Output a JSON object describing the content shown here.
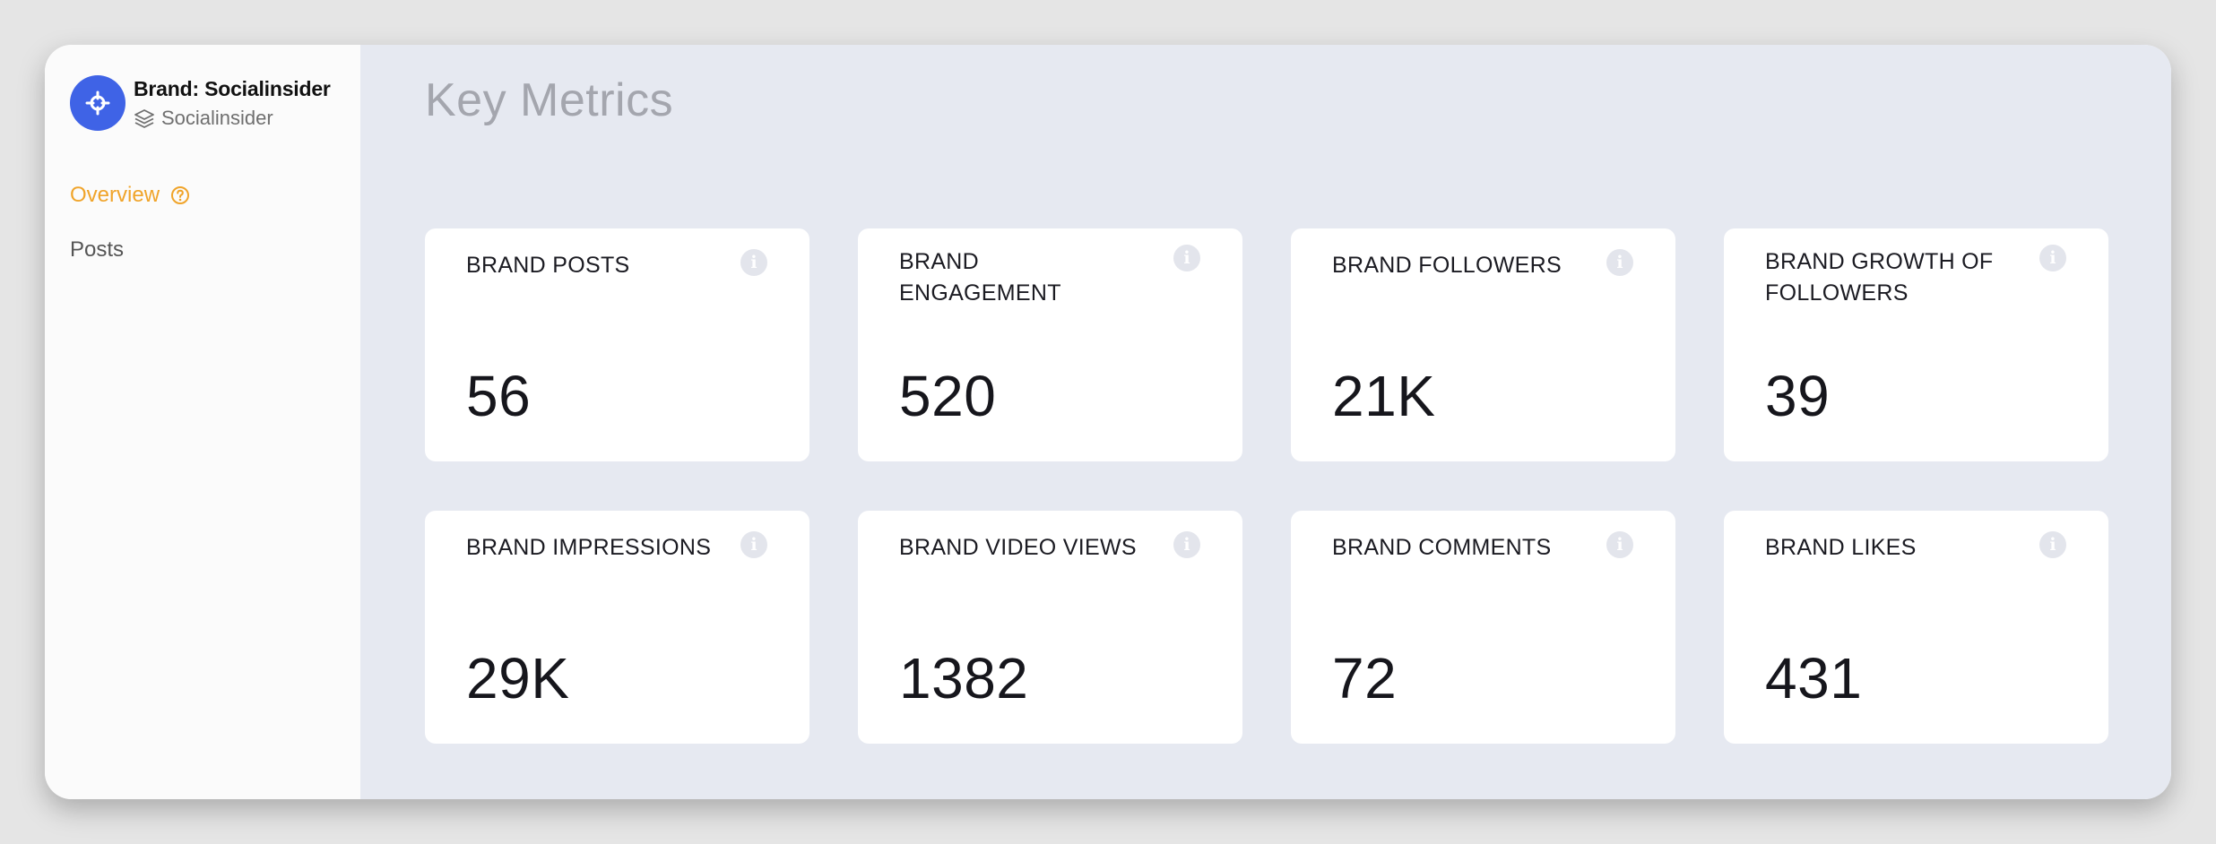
{
  "brand": {
    "name": "Brand: Socialinsider",
    "account": "Socialinsider",
    "avatar_color": "#3f63e6"
  },
  "nav": {
    "items": [
      {
        "label": "Overview",
        "active": true,
        "icon": "help-circle-icon"
      },
      {
        "label": "Posts",
        "active": false
      }
    ],
    "active_color": "#f0a42a"
  },
  "main": {
    "title": "Key Metrics",
    "metrics": [
      {
        "label": "BRAND POSTS",
        "value": "56",
        "icon": "info-icon"
      },
      {
        "label": "BRAND ENGAGEMENT",
        "value": "520",
        "icon": "info-icon"
      },
      {
        "label": "BRAND FOLLOWERS",
        "value": "21K",
        "icon": "info-icon"
      },
      {
        "label": "BRAND GROWTH OF FOLLOWERS",
        "value": "39",
        "icon": "info-icon"
      },
      {
        "label": "BRAND IMPRESSIONS",
        "value": "29K",
        "icon": "info-icon"
      },
      {
        "label": "BRAND VIDEO VIEWS",
        "value": "1382",
        "icon": "info-icon"
      },
      {
        "label": "BRAND COMMENTS",
        "value": "72",
        "icon": "info-icon"
      },
      {
        "label": "BRAND LIKES",
        "value": "431",
        "icon": "info-icon"
      }
    ]
  }
}
